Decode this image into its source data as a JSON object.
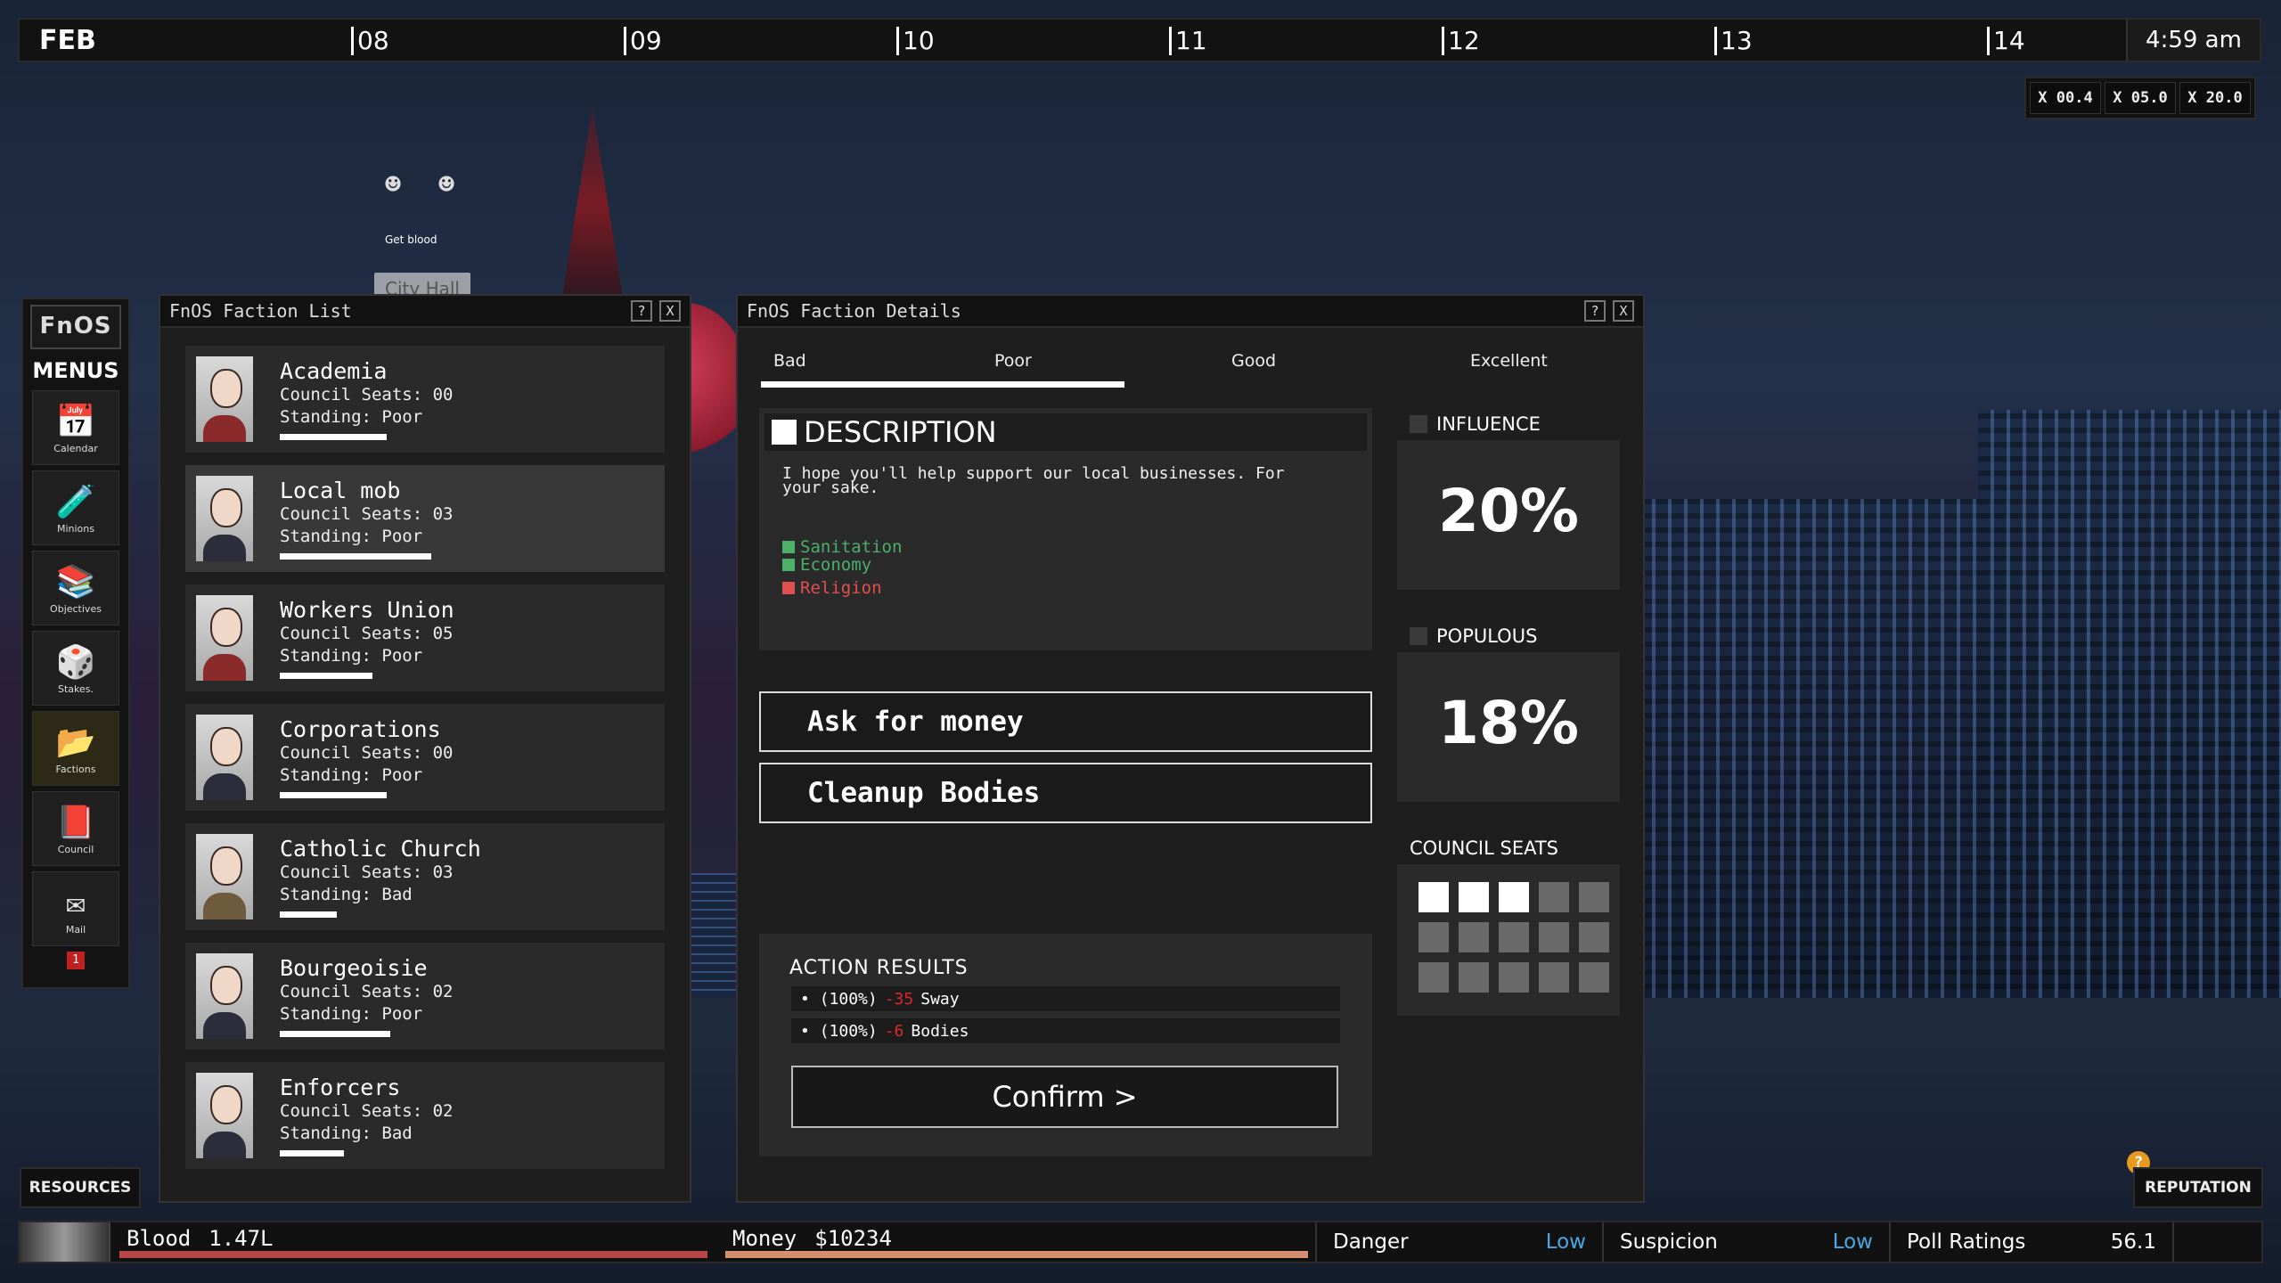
{
  "timeline": {
    "month": "FEB",
    "days": [
      "08",
      "09",
      "10",
      "11",
      "12",
      "13",
      "14"
    ],
    "time": "4:59 am"
  },
  "speed": [
    "X 00.4",
    "X 05.0",
    "X 20.0"
  ],
  "map": {
    "actor_label": "Get blood",
    "city_hall": "City Hall"
  },
  "menu": {
    "logo": "FnOS",
    "title": "MENUS",
    "items": [
      {
        "label": "Calendar",
        "icon": "calendar-icon"
      },
      {
        "label": "Minions",
        "icon": "minions-icon"
      },
      {
        "label": "Objectives",
        "icon": "objectives-icon"
      },
      {
        "label": "Stakes.",
        "icon": "stakes-icon"
      },
      {
        "label": "Factions",
        "icon": "factions-icon"
      },
      {
        "label": "Council",
        "icon": "council-icon"
      },
      {
        "label": "Mail",
        "icon": "mail-icon"
      }
    ],
    "mail_badge": "1"
  },
  "faction_list": {
    "title": "FnOS Faction List",
    "help": "?",
    "close": "X",
    "factions": [
      {
        "name": "Academia",
        "seats": "Council Seats: 00",
        "standing": "Standing: Poor",
        "bar": 0.6
      },
      {
        "name": "Local mob",
        "seats": "Council Seats: 03",
        "standing": "Standing: Poor",
        "bar": 0.85
      },
      {
        "name": "Workers Union",
        "seats": "Council Seats: 05",
        "standing": "Standing: Poor",
        "bar": 0.52
      },
      {
        "name": "Corporations",
        "seats": "Council Seats: 00",
        "standing": "Standing: Poor",
        "bar": 0.6
      },
      {
        "name": "Catholic Church",
        "seats": "Council Seats: 03",
        "standing": "Standing: Bad",
        "bar": 0.32
      },
      {
        "name": "Bourgeoisie",
        "seats": "Council Seats: 02",
        "standing": "Standing: Poor",
        "bar": 0.62
      },
      {
        "name": "Enforcers",
        "seats": "Council Seats: 02",
        "standing": "Standing: Bad",
        "bar": 0.36
      }
    ]
  },
  "faction_details": {
    "title": "FnOS Faction Details",
    "help": "?",
    "close": "X",
    "scale": [
      "Bad",
      "Poor",
      "Good",
      "Excellent"
    ],
    "standing_fraction": 0.4,
    "description_title": "DESCRIPTION",
    "description": "I hope you'll help support our local businesses. For your sake.",
    "tags": [
      {
        "label": "Sanitation",
        "color": "#4caf6a"
      },
      {
        "label": "Economy",
        "color": "#4caf6a"
      },
      {
        "label": "Religion",
        "color": "#e05050"
      }
    ],
    "actions": [
      "Ask for money",
      "Cleanup Bodies"
    ],
    "results_title": "ACTION RESULTS",
    "results": [
      {
        "chance": "(100%)",
        "delta": "-35",
        "item": "Sway"
      },
      {
        "chance": "(100%)",
        "delta": "-6",
        "item": "Bodies"
      }
    ],
    "confirm": "Confirm >",
    "influence_title": "INFLUENCE",
    "influence_value": "20%",
    "populous_title": "POPULOUS",
    "populous_value": "18%",
    "seats_title": "COUNCIL SEATS",
    "seats_filled": 3,
    "seats_total": 15
  },
  "bottom": {
    "resources": "RESOURCES",
    "reputation": "REPUTATION",
    "alert": "?",
    "blood_label": "Blood",
    "blood_value": "1.47L",
    "blood_fraction": 1.0,
    "money_label": "Money",
    "money_value": "$10234",
    "money_fraction": 1.0,
    "danger_label": "Danger",
    "danger_value": "Low",
    "suspicion_label": "Suspicion",
    "suspicion_value": "Low",
    "poll_label": "Poll Ratings",
    "poll_value": "56.1"
  },
  "colors": {
    "negative": "#e02828",
    "low_status": "#4aa8e0",
    "blood_bar": "#b84848",
    "money_bar": "#d49070"
  }
}
